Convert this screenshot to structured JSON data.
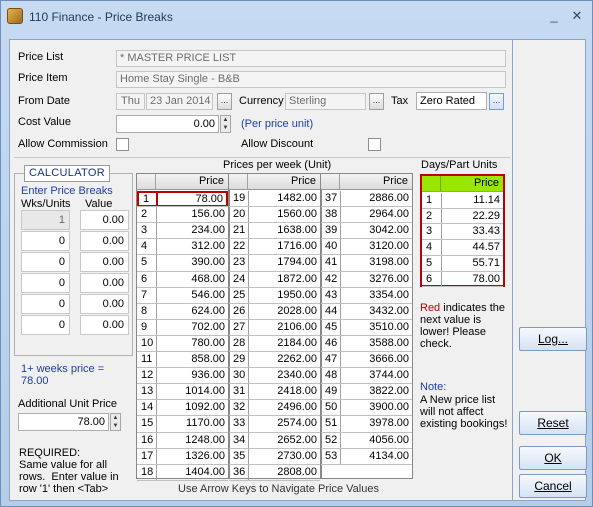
{
  "window": {
    "title": "110 Finance - Price Breaks",
    "minimize": "_",
    "close": "✕"
  },
  "form": {
    "price_list_label": "Price List",
    "price_list": "* MASTER PRICE LIST",
    "price_item_label": "Price Item",
    "price_item": "Home Stay Single - B&B",
    "from_date_label": "From Date",
    "from_day": "Thu",
    "from_date": "23 Jan 2014",
    "currency_label": "Currency",
    "currency": "Sterling",
    "tax_label": "Tax",
    "tax": "Zero Rated",
    "cost_value_label": "Cost Value",
    "cost_value": "0.00",
    "per_unit": "(Per price unit)",
    "allow_commission_label": "Allow Commission",
    "allow_discount_label": "Allow Discount",
    "ellipsis": "..."
  },
  "calculator": {
    "title": "CALCULATOR",
    "enter": "Enter Price Breaks",
    "col_wks": "Wks/Units",
    "col_value": "Value",
    "rows": [
      [
        "1",
        "0.00"
      ],
      [
        "0",
        "0.00"
      ],
      [
        "0",
        "0.00"
      ],
      [
        "0",
        "0.00"
      ],
      [
        "0",
        "0.00"
      ],
      [
        "0",
        "0.00"
      ]
    ],
    "summary": "1+ weeks price = 78.00",
    "additional_label": "Additional Unit Price",
    "additional_value": "78.00",
    "required": "REQUIRED:\nSame value for all rows.  Enter value in row '1' then <Tab>"
  },
  "weekly": {
    "title": "Prices per week (Unit)",
    "price_header": "Price",
    "col1": [
      [
        "1",
        "78.00"
      ],
      [
        "2",
        "156.00"
      ],
      [
        "3",
        "234.00"
      ],
      [
        "4",
        "312.00"
      ],
      [
        "5",
        "390.00"
      ],
      [
        "6",
        "468.00"
      ],
      [
        "7",
        "546.00"
      ],
      [
        "8",
        "624.00"
      ],
      [
        "9",
        "702.00"
      ],
      [
        "10",
        "780.00"
      ],
      [
        "11",
        "858.00"
      ],
      [
        "12",
        "936.00"
      ],
      [
        "13",
        "1014.00"
      ],
      [
        "14",
        "1092.00"
      ],
      [
        "15",
        "1170.00"
      ],
      [
        "16",
        "1248.00"
      ],
      [
        "17",
        "1326.00"
      ],
      [
        "18",
        "1404.00"
      ]
    ],
    "col2": [
      [
        "19",
        "1482.00"
      ],
      [
        "20",
        "1560.00"
      ],
      [
        "21",
        "1638.00"
      ],
      [
        "22",
        "1716.00"
      ],
      [
        "23",
        "1794.00"
      ],
      [
        "24",
        "1872.00"
      ],
      [
        "25",
        "1950.00"
      ],
      [
        "26",
        "2028.00"
      ],
      [
        "27",
        "2106.00"
      ],
      [
        "28",
        "2184.00"
      ],
      [
        "29",
        "2262.00"
      ],
      [
        "30",
        "2340.00"
      ],
      [
        "31",
        "2418.00"
      ],
      [
        "32",
        "2496.00"
      ],
      [
        "33",
        "2574.00"
      ],
      [
        "34",
        "2652.00"
      ],
      [
        "35",
        "2730.00"
      ],
      [
        "36",
        "2808.00"
      ]
    ],
    "col3": [
      [
        "37",
        "2886.00"
      ],
      [
        "38",
        "2964.00"
      ],
      [
        "39",
        "3042.00"
      ],
      [
        "40",
        "3120.00"
      ],
      [
        "41",
        "3198.00"
      ],
      [
        "42",
        "3276.00"
      ],
      [
        "43",
        "3354.00"
      ],
      [
        "44",
        "3432.00"
      ],
      [
        "45",
        "3510.00"
      ],
      [
        "46",
        "3588.00"
      ],
      [
        "47",
        "3666.00"
      ],
      [
        "48",
        "3744.00"
      ],
      [
        "49",
        "3822.00"
      ],
      [
        "50",
        "3900.00"
      ],
      [
        "51",
        "3978.00"
      ],
      [
        "52",
        "4056.00"
      ],
      [
        "53",
        "4134.00"
      ]
    ],
    "hint": "Use Arrow Keys to Navigate Price Values"
  },
  "days": {
    "title": "Days/Part Units",
    "price_header": "Price",
    "rows": [
      [
        "1",
        "11.14"
      ],
      [
        "2",
        "22.29"
      ],
      [
        "3",
        "33.43"
      ],
      [
        "4",
        "44.57"
      ],
      [
        "5",
        "55.71"
      ],
      [
        "6",
        "78.00"
      ]
    ],
    "red_word": "Red",
    "red_note": " indicates the next value is lower!  Please check.",
    "note_label": "Note:",
    "note": "A New price list will not affect existing bookings!"
  },
  "buttons": {
    "log": "Log...",
    "reset": "Reset",
    "ok": "OK",
    "cancel": "Cancel"
  },
  "colors": {
    "accent_red": "#c00000",
    "days_header_green": "#99e600",
    "label_blue": "#1c3fa8"
  }
}
